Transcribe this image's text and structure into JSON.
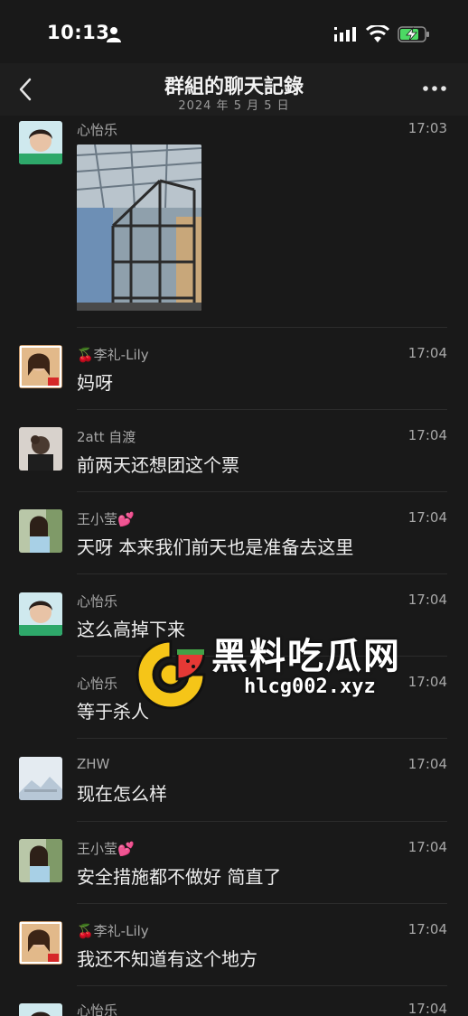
{
  "status": {
    "time": "10:13"
  },
  "nav": {
    "title": "群組的聊天記錄",
    "subtitle": "2024 年 5 月 5 日"
  },
  "messages": [
    {
      "sender": "心怡乐",
      "time": "17:03",
      "text": ""
    },
    {
      "sender": "🍒李礼-Lily",
      "time": "17:04",
      "text": "妈呀"
    },
    {
      "sender": "2att 自渡",
      "time": "17:04",
      "text": "前两天还想团这个票"
    },
    {
      "sender": "王小莹💕",
      "time": "17:04",
      "text": "天呀 本来我们前天也是准备去这里"
    },
    {
      "sender": "心怡乐",
      "time": "17:04",
      "text": "这么高掉下来"
    },
    {
      "sender": "心怡乐",
      "time": "17:04",
      "text": "等于杀人"
    },
    {
      "sender": "ZHW",
      "time": "17:04",
      "text": "现在怎么样"
    },
    {
      "sender": "王小莹💕",
      "time": "17:04",
      "text": "安全措施都不做好 简直了"
    },
    {
      "sender": "🍒李礼-Lily",
      "time": "17:04",
      "text": "我还不知道有这个地方"
    },
    {
      "sender": "心怡乐",
      "time": "17:04",
      "text": ""
    }
  ],
  "watermark": {
    "title": "黑料吃瓜网",
    "url": "hlcg002.xyz"
  },
  "icons": {
    "back": "chevron-left-icon",
    "more": "more-dots-icon",
    "signal": "signal-icon",
    "wifi": "wifi-icon",
    "battery": "battery-charging-icon"
  },
  "colors": {
    "background": "#191919",
    "header": "#1e1e1e",
    "battery": "#4cd964",
    "watermark_yellow": "#f5c518"
  }
}
